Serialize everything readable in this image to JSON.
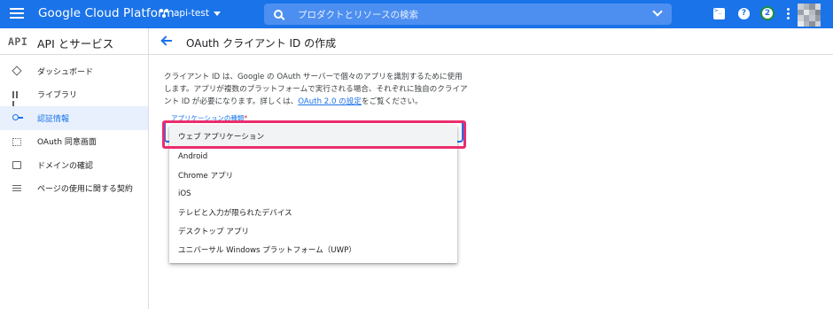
{
  "topbar": {
    "brand": "Google Cloud Platform",
    "project": "api-test",
    "search_placeholder": "プロダクトとリソースの検索",
    "notification_count": "2",
    "colors": {
      "bar": "#1a73e8",
      "search": "#4d8ff0"
    },
    "icons": [
      "menu-icon",
      "project-icon",
      "search-icon",
      "expand-icon",
      "cloud-shell-icon",
      "help-icon",
      "more-vert-icon",
      "avatar"
    ]
  },
  "subheader": {
    "logo": "API",
    "section_title": "API とサービス",
    "page_title": "OAuth クライアント ID の作成"
  },
  "sidebar": {
    "items": [
      {
        "label": "ダッシュボード",
        "icon": "dashboard-icon",
        "active": false
      },
      {
        "label": "ライブラリ",
        "icon": "library-icon",
        "active": false
      },
      {
        "label": "認証情報",
        "icon": "key-icon",
        "active": true
      },
      {
        "label": "OAuth 同意画面",
        "icon": "consent-screen-icon",
        "active": false
      },
      {
        "label": "ドメインの確認",
        "icon": "domain-icon",
        "active": false
      },
      {
        "label": "ページの使用に関する契約",
        "icon": "terms-icon",
        "active": false
      }
    ]
  },
  "main": {
    "description_1": "クライアント ID は、Google の OAuth サーバーで個々のアプリを識別するために使用します。アプリが複数のプラットフォームで実行される場合、それぞれに独自のクライアント ID が必要になります。詳しくは、",
    "description_link": "OAuth 2.0 の設定",
    "description_2": "をご覧ください。",
    "field_label": "アプリケーションの種類",
    "required_mark": "*",
    "highlight_color": "#ea2d6d",
    "options": [
      "ウェブ アプリケーション",
      "Android",
      "Chrome アプリ",
      "iOS",
      "テレビと入力が限られたデバイス",
      "デスクトップ アプリ",
      "ユニバーサル Windows プラットフォーム（UWP）"
    ],
    "selected_index": 0
  }
}
